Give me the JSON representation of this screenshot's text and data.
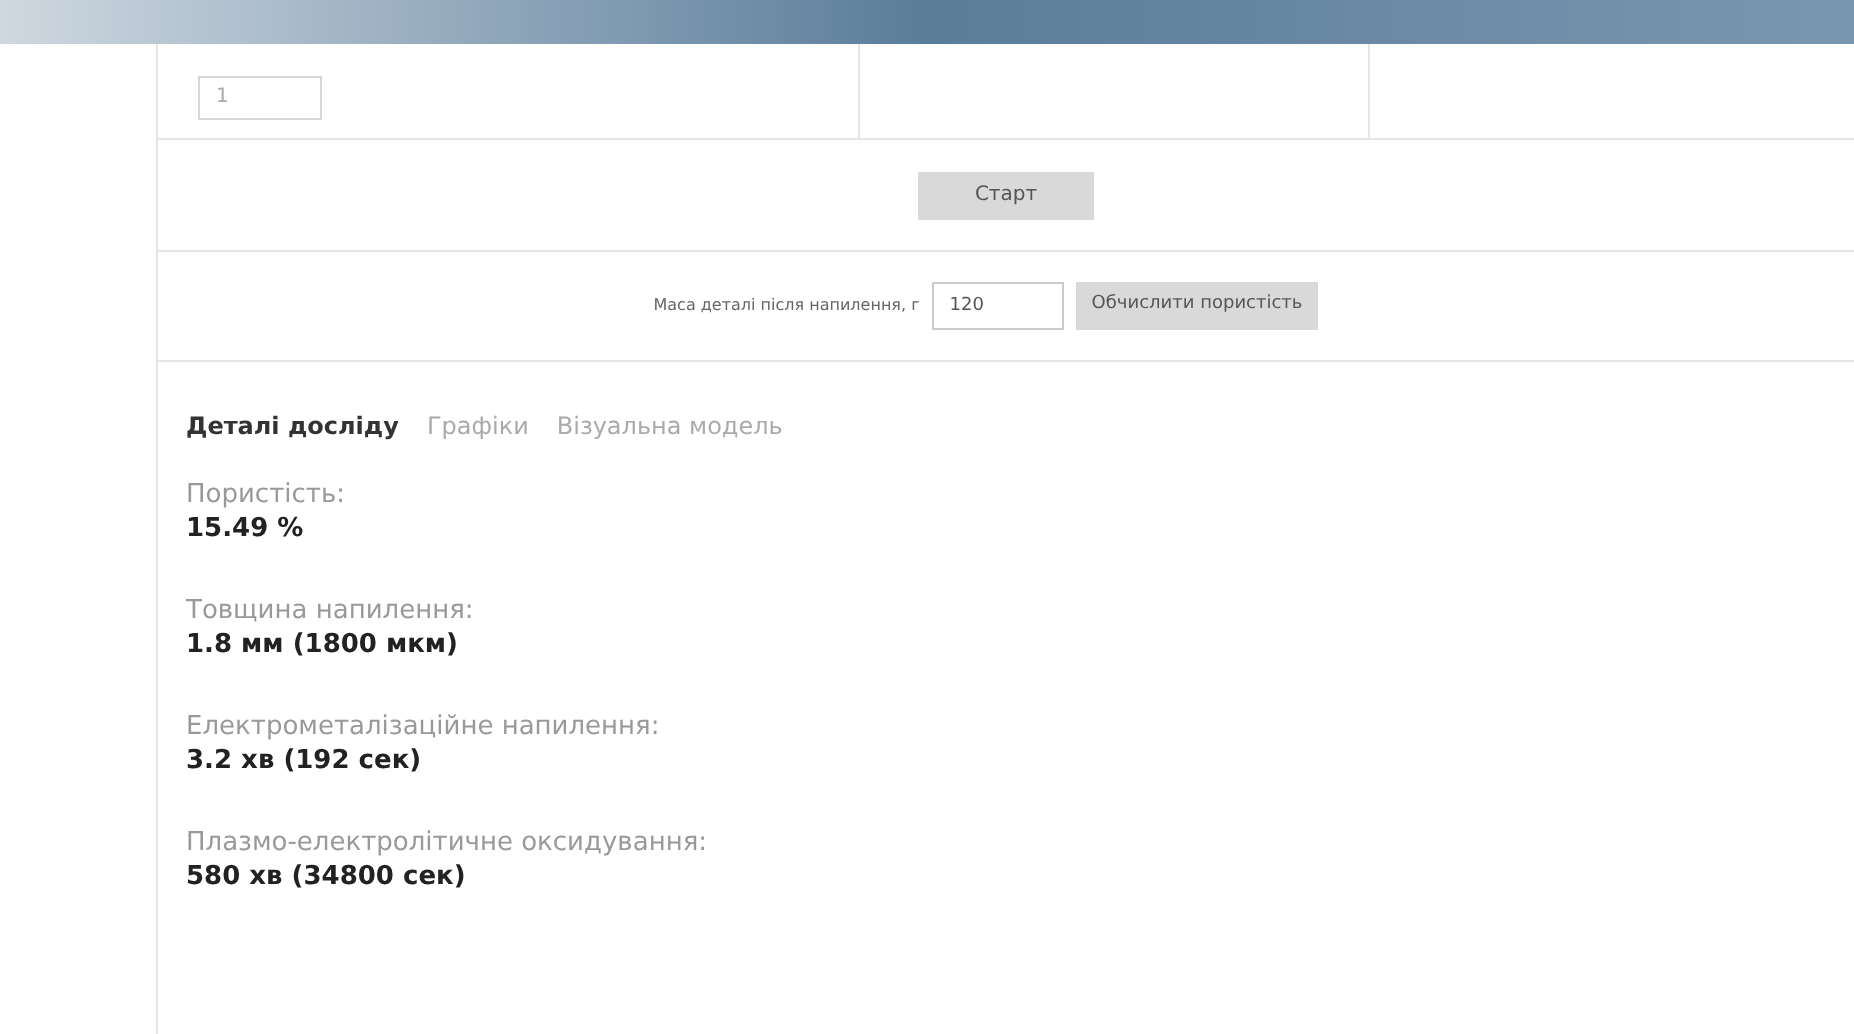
{
  "top_row": {
    "field_value": "1"
  },
  "start_button": "Старт",
  "mass": {
    "label": "Маса деталі після напилення, г",
    "value": "120",
    "button": "Обчислити пористість"
  },
  "tabs": [
    {
      "label": "Деталі досліду",
      "selected": true
    },
    {
      "label": "Графіки",
      "selected": false
    },
    {
      "label": "Візуальна модель",
      "selected": false
    }
  ],
  "details": [
    {
      "label": "Пористість:",
      "value": "15.49 %"
    },
    {
      "label": "Товщина напилення:",
      "value": "1.8 мм (1800 мкм)"
    },
    {
      "label": "Електрометалізаційне напилення:",
      "value": "3.2 хв (192 сек)"
    },
    {
      "label": "Плазмо-електролітичне оксидування:",
      "value": "580 хв (34800 сек)"
    }
  ]
}
